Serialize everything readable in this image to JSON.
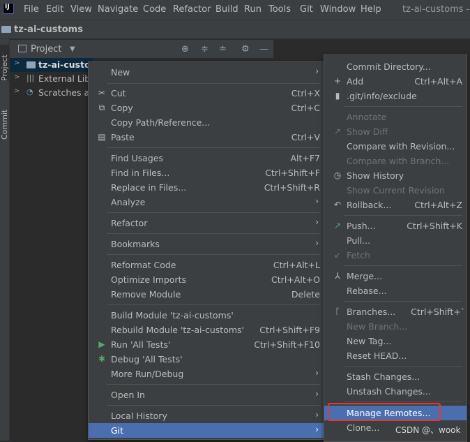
{
  "menubar": {
    "items": [
      "File",
      "Edit",
      "View",
      "Navigate",
      "Code",
      "Refactor",
      "Build",
      "Run",
      "Tools",
      "Git",
      "Window",
      "Help"
    ],
    "window_title": "tz-ai-customs - A"
  },
  "navbar": {
    "title": "tz-ai-customs"
  },
  "left_stripe": {
    "project": "Project",
    "commit": "Commit"
  },
  "project_panel": {
    "title": "Project",
    "tree": [
      "tz-ai-custom",
      "External Libr",
      "Scratches an"
    ]
  },
  "context_menu": {
    "items": [
      {
        "label": "New"
      },
      {
        "label": "Cut",
        "shortcut": "Ctrl+X"
      },
      {
        "label": "Copy",
        "shortcut": "Ctrl+C"
      },
      {
        "label": "Copy Path/Reference..."
      },
      {
        "label": "Paste",
        "shortcut": "Ctrl+V"
      },
      {
        "label": "Find Usages",
        "shortcut": "Alt+F7"
      },
      {
        "label": "Find in Files...",
        "shortcut": "Ctrl+Shift+F"
      },
      {
        "label": "Replace in Files...",
        "shortcut": "Ctrl+Shift+R"
      },
      {
        "label": "Analyze"
      },
      {
        "label": "Refactor"
      },
      {
        "label": "Bookmarks"
      },
      {
        "label": "Reformat Code",
        "shortcut": "Ctrl+Alt+L"
      },
      {
        "label": "Optimize Imports",
        "shortcut": "Ctrl+Alt+O"
      },
      {
        "label": "Remove Module",
        "shortcut": "Delete"
      },
      {
        "label": "Build Module 'tz-ai-customs'"
      },
      {
        "label": "Rebuild Module 'tz-ai-customs'",
        "shortcut": "Ctrl+Shift+F9"
      },
      {
        "label": "Run 'All Tests'",
        "shortcut": "Ctrl+Shift+F10"
      },
      {
        "label": "Debug 'All Tests'"
      },
      {
        "label": "More Run/Debug"
      },
      {
        "label": "Open In"
      },
      {
        "label": "Local History"
      },
      {
        "label": "Git"
      }
    ]
  },
  "git_menu": {
    "items": [
      {
        "label": "Commit Directory..."
      },
      {
        "label": "Add",
        "shortcut": "Ctrl+Alt+A"
      },
      {
        "label": ".git/info/exclude"
      },
      {
        "label": "Annotate"
      },
      {
        "label": "Show Diff"
      },
      {
        "label": "Compare with Revision..."
      },
      {
        "label": "Compare with Branch..."
      },
      {
        "label": "Show History"
      },
      {
        "label": "Show Current Revision"
      },
      {
        "label": "Rollback...",
        "shortcut": "Ctrl+Alt+Z"
      },
      {
        "label": "Push...",
        "shortcut": "Ctrl+Shift+K"
      },
      {
        "label": "Pull..."
      },
      {
        "label": "Fetch"
      },
      {
        "label": "Merge..."
      },
      {
        "label": "Rebase..."
      },
      {
        "label": "Branches...",
        "shortcut": "Ctrl+Shift+`"
      },
      {
        "label": "New Branch..."
      },
      {
        "label": "New Tag..."
      },
      {
        "label": "Reset HEAD..."
      },
      {
        "label": "Stash Changes..."
      },
      {
        "label": "Unstash Changes..."
      },
      {
        "label": "Manage Remotes..."
      },
      {
        "label": "Clone..."
      }
    ]
  },
  "watermark": "CSDN @、wook",
  "colors": {
    "highlight": "#4b6eaf",
    "annotation_box": "#e53935",
    "menu_bg": "#3c3f41"
  }
}
